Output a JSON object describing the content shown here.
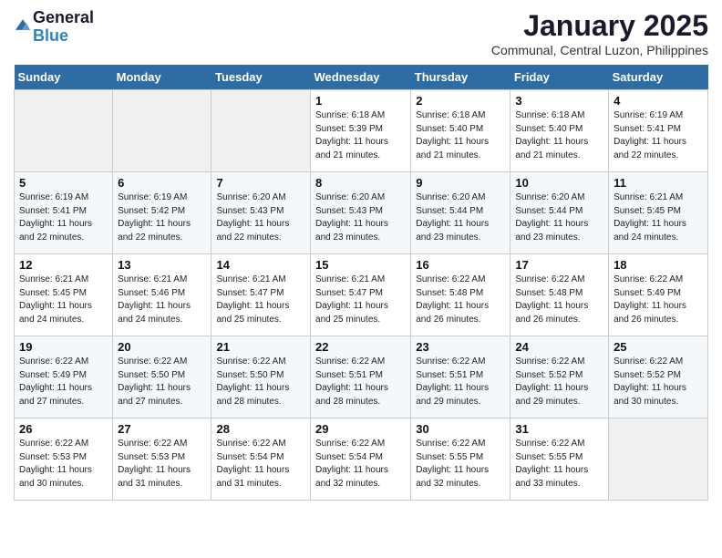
{
  "header": {
    "logo_line1": "General",
    "logo_line2": "Blue",
    "month": "January 2025",
    "location": "Communal, Central Luzon, Philippines"
  },
  "weekdays": [
    "Sunday",
    "Monday",
    "Tuesday",
    "Wednesday",
    "Thursday",
    "Friday",
    "Saturday"
  ],
  "weeks": [
    [
      {
        "day": "",
        "info": ""
      },
      {
        "day": "",
        "info": ""
      },
      {
        "day": "",
        "info": ""
      },
      {
        "day": "1",
        "info": "Sunrise: 6:18 AM\nSunset: 5:39 PM\nDaylight: 11 hours and 21 minutes."
      },
      {
        "day": "2",
        "info": "Sunrise: 6:18 AM\nSunset: 5:40 PM\nDaylight: 11 hours and 21 minutes."
      },
      {
        "day": "3",
        "info": "Sunrise: 6:18 AM\nSunset: 5:40 PM\nDaylight: 11 hours and 21 minutes."
      },
      {
        "day": "4",
        "info": "Sunrise: 6:19 AM\nSunset: 5:41 PM\nDaylight: 11 hours and 22 minutes."
      }
    ],
    [
      {
        "day": "5",
        "info": "Sunrise: 6:19 AM\nSunset: 5:41 PM\nDaylight: 11 hours and 22 minutes."
      },
      {
        "day": "6",
        "info": "Sunrise: 6:19 AM\nSunset: 5:42 PM\nDaylight: 11 hours and 22 minutes."
      },
      {
        "day": "7",
        "info": "Sunrise: 6:20 AM\nSunset: 5:43 PM\nDaylight: 11 hours and 22 minutes."
      },
      {
        "day": "8",
        "info": "Sunrise: 6:20 AM\nSunset: 5:43 PM\nDaylight: 11 hours and 23 minutes."
      },
      {
        "day": "9",
        "info": "Sunrise: 6:20 AM\nSunset: 5:44 PM\nDaylight: 11 hours and 23 minutes."
      },
      {
        "day": "10",
        "info": "Sunrise: 6:20 AM\nSunset: 5:44 PM\nDaylight: 11 hours and 23 minutes."
      },
      {
        "day": "11",
        "info": "Sunrise: 6:21 AM\nSunset: 5:45 PM\nDaylight: 11 hours and 24 minutes."
      }
    ],
    [
      {
        "day": "12",
        "info": "Sunrise: 6:21 AM\nSunset: 5:45 PM\nDaylight: 11 hours and 24 minutes."
      },
      {
        "day": "13",
        "info": "Sunrise: 6:21 AM\nSunset: 5:46 PM\nDaylight: 11 hours and 24 minutes."
      },
      {
        "day": "14",
        "info": "Sunrise: 6:21 AM\nSunset: 5:47 PM\nDaylight: 11 hours and 25 minutes."
      },
      {
        "day": "15",
        "info": "Sunrise: 6:21 AM\nSunset: 5:47 PM\nDaylight: 11 hours and 25 minutes."
      },
      {
        "day": "16",
        "info": "Sunrise: 6:22 AM\nSunset: 5:48 PM\nDaylight: 11 hours and 26 minutes."
      },
      {
        "day": "17",
        "info": "Sunrise: 6:22 AM\nSunset: 5:48 PM\nDaylight: 11 hours and 26 minutes."
      },
      {
        "day": "18",
        "info": "Sunrise: 6:22 AM\nSunset: 5:49 PM\nDaylight: 11 hours and 26 minutes."
      }
    ],
    [
      {
        "day": "19",
        "info": "Sunrise: 6:22 AM\nSunset: 5:49 PM\nDaylight: 11 hours and 27 minutes."
      },
      {
        "day": "20",
        "info": "Sunrise: 6:22 AM\nSunset: 5:50 PM\nDaylight: 11 hours and 27 minutes."
      },
      {
        "day": "21",
        "info": "Sunrise: 6:22 AM\nSunset: 5:50 PM\nDaylight: 11 hours and 28 minutes."
      },
      {
        "day": "22",
        "info": "Sunrise: 6:22 AM\nSunset: 5:51 PM\nDaylight: 11 hours and 28 minutes."
      },
      {
        "day": "23",
        "info": "Sunrise: 6:22 AM\nSunset: 5:51 PM\nDaylight: 11 hours and 29 minutes."
      },
      {
        "day": "24",
        "info": "Sunrise: 6:22 AM\nSunset: 5:52 PM\nDaylight: 11 hours and 29 minutes."
      },
      {
        "day": "25",
        "info": "Sunrise: 6:22 AM\nSunset: 5:52 PM\nDaylight: 11 hours and 30 minutes."
      }
    ],
    [
      {
        "day": "26",
        "info": "Sunrise: 6:22 AM\nSunset: 5:53 PM\nDaylight: 11 hours and 30 minutes."
      },
      {
        "day": "27",
        "info": "Sunrise: 6:22 AM\nSunset: 5:53 PM\nDaylight: 11 hours and 31 minutes."
      },
      {
        "day": "28",
        "info": "Sunrise: 6:22 AM\nSunset: 5:54 PM\nDaylight: 11 hours and 31 minutes."
      },
      {
        "day": "29",
        "info": "Sunrise: 6:22 AM\nSunset: 5:54 PM\nDaylight: 11 hours and 32 minutes."
      },
      {
        "day": "30",
        "info": "Sunrise: 6:22 AM\nSunset: 5:55 PM\nDaylight: 11 hours and 32 minutes."
      },
      {
        "day": "31",
        "info": "Sunrise: 6:22 AM\nSunset: 5:55 PM\nDaylight: 11 hours and 33 minutes."
      },
      {
        "day": "",
        "info": ""
      }
    ]
  ]
}
